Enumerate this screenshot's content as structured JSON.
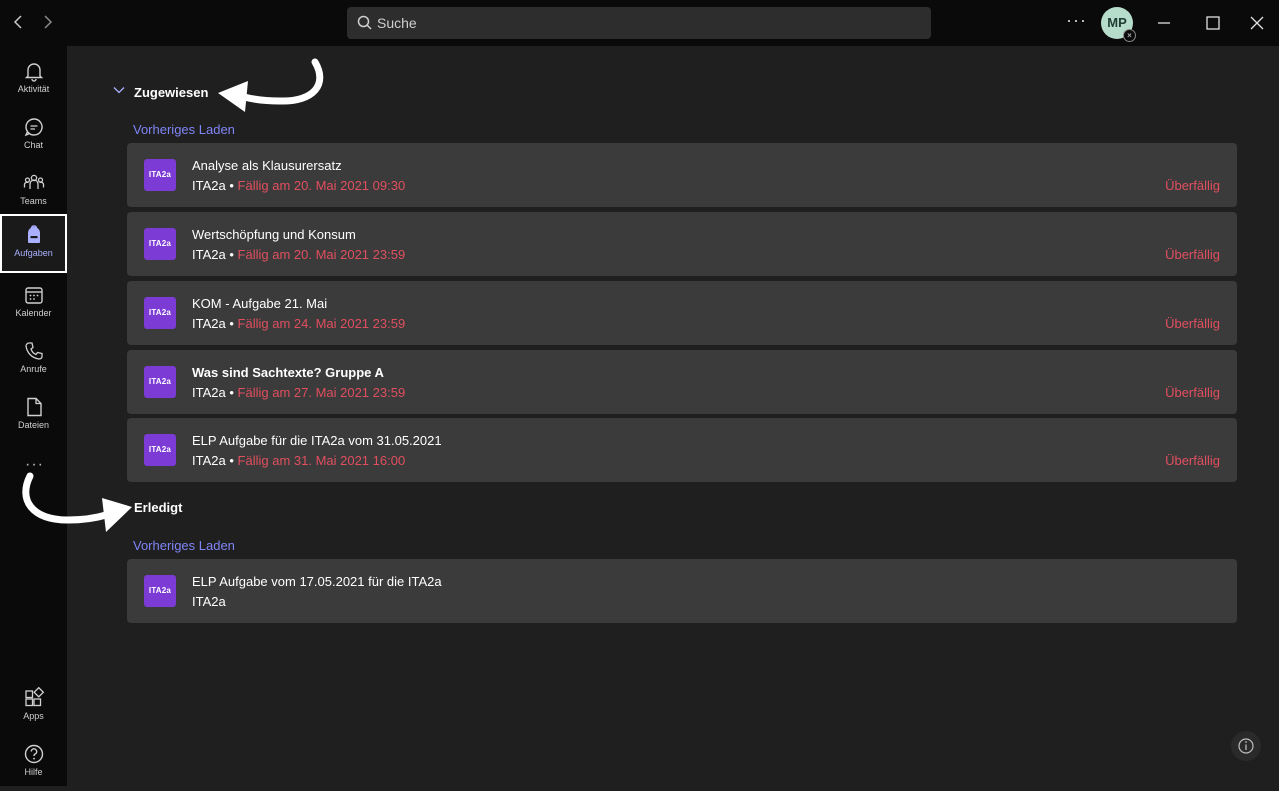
{
  "search": {
    "placeholder": "Suche"
  },
  "user": {
    "initials": "MP"
  },
  "rail": [
    {
      "label": "Aktivität"
    },
    {
      "label": "Chat"
    },
    {
      "label": "Teams"
    },
    {
      "label": "Aufgaben"
    },
    {
      "label": "Kalender"
    },
    {
      "label": "Anrufe"
    },
    {
      "label": "Dateien"
    },
    {
      "label": "Apps"
    },
    {
      "label": "Hilfe"
    }
  ],
  "assigned": {
    "heading": "Zugewiesen",
    "load_prev": "Vorheriges Laden",
    "items": [
      {
        "title": "Analyse als Klausurersatz",
        "class": "ITA2a",
        "due": "Fällig am 20. Mai 2021 09:30",
        "status": "Überfällig",
        "icon_text": "ITA2a"
      },
      {
        "title": "Wertschöpfung und Konsum",
        "class": "ITA2a",
        "due": "Fällig am 20. Mai 2021 23:59",
        "status": "Überfällig",
        "icon_text": "ITA2a"
      },
      {
        "title": "KOM - Aufgabe 21. Mai",
        "class": "ITA2a",
        "due": "Fällig am 24. Mai 2021 23:59",
        "status": "Überfällig",
        "icon_text": "ITA2a"
      },
      {
        "title": "Was sind Sachtexte? Gruppe A",
        "class": "ITA2a",
        "due": "Fällig am 27. Mai 2021 23:59",
        "status": "Überfällig",
        "icon_text": "ITA2a"
      },
      {
        "title": "ELP Aufgabe für die ITA2a vom 31.05.2021",
        "class": "ITA2a",
        "due": "Fällig am 31. Mai 2021 16:00",
        "status": "Überfällig",
        "icon_text": "ITA2a"
      }
    ]
  },
  "done": {
    "heading": "Erledigt",
    "load_prev": "Vorheriges Laden",
    "items": [
      {
        "title": "ELP Aufgabe vom 17.05.2021 für die ITA2a",
        "class": "ITA2a",
        "icon_text": "ITA2a"
      }
    ]
  },
  "separator": "•",
  "colors": {
    "accent": "#7f85f5",
    "overdue": "#e04f5f",
    "card": "#3b3b3b",
    "class_icon": "#7b3bd4"
  }
}
